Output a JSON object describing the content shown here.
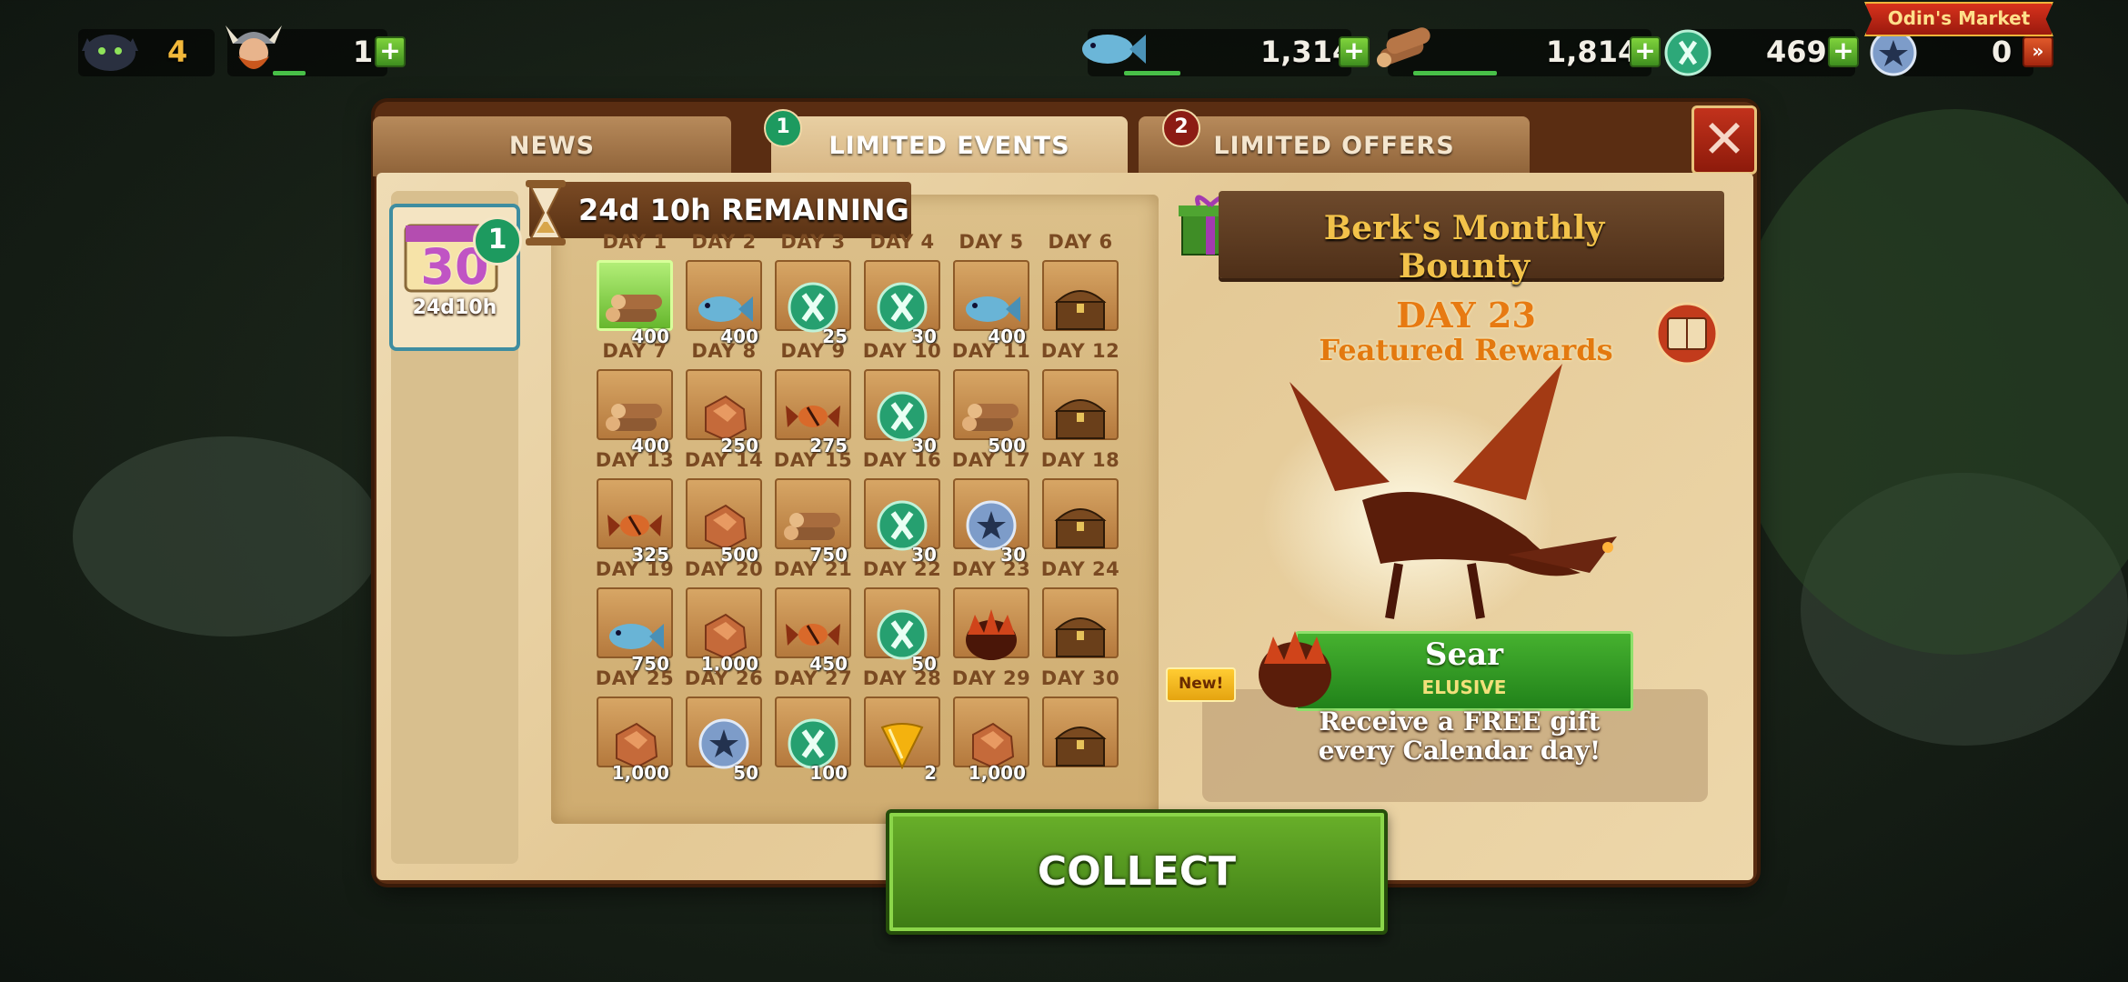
{
  "hud": {
    "dragons_count": "4",
    "vikings_count": "1",
    "fish_amount": "1,314",
    "wood_amount": "1,814",
    "runes_amount": "469",
    "coins_amount": "0",
    "market_label": "Odin's Market"
  },
  "tabs": {
    "news": "NEWS",
    "limited_events": "LIMITED EVENTS",
    "limited_events_badge": "1",
    "limited_offers": "LIMITED OFFERS",
    "limited_offers_badge": "2"
  },
  "sidebar": {
    "calendar_number": "30",
    "calendar_time": "24d10h",
    "calendar_badge": "1"
  },
  "calendar": {
    "remaining": "24d 10h REMAINING",
    "days": [
      {
        "label": "DAY 1",
        "reward": "wood",
        "amount": "400"
      },
      {
        "label": "DAY 2",
        "reward": "fish",
        "amount": "400"
      },
      {
        "label": "DAY 3",
        "reward": "rune",
        "amount": "25"
      },
      {
        "label": "DAY 4",
        "reward": "rune",
        "amount": "30"
      },
      {
        "label": "DAY 5",
        "reward": "fish",
        "amount": "400"
      },
      {
        "label": "DAY 6",
        "reward": "chest",
        "amount": ""
      },
      {
        "label": "DAY 7",
        "reward": "wood",
        "amount": "400"
      },
      {
        "label": "DAY 8",
        "reward": "iron",
        "amount": "250"
      },
      {
        "label": "DAY 9",
        "reward": "candy",
        "amount": "275"
      },
      {
        "label": "DAY 10",
        "reward": "rune",
        "amount": "30"
      },
      {
        "label": "DAY 11",
        "reward": "wood",
        "amount": "500"
      },
      {
        "label": "DAY 12",
        "reward": "chest",
        "amount": ""
      },
      {
        "label": "DAY 13",
        "reward": "candy",
        "amount": "325"
      },
      {
        "label": "DAY 14",
        "reward": "iron",
        "amount": "500"
      },
      {
        "label": "DAY 15",
        "reward": "wood",
        "amount": "750"
      },
      {
        "label": "DAY 16",
        "reward": "rune",
        "amount": "30"
      },
      {
        "label": "DAY 17",
        "reward": "coin",
        "amount": "30"
      },
      {
        "label": "DAY 18",
        "reward": "chest",
        "amount": ""
      },
      {
        "label": "DAY 19",
        "reward": "fish",
        "amount": "750"
      },
      {
        "label": "DAY 20",
        "reward": "iron",
        "amount": "1,000"
      },
      {
        "label": "DAY 21",
        "reward": "candy",
        "amount": "450"
      },
      {
        "label": "DAY 22",
        "reward": "rune",
        "amount": "50"
      },
      {
        "label": "DAY 23",
        "reward": "egg",
        "amount": ""
      },
      {
        "label": "DAY 24",
        "reward": "chest",
        "amount": ""
      },
      {
        "label": "DAY 25",
        "reward": "iron",
        "amount": "1,000"
      },
      {
        "label": "DAY 26",
        "reward": "coin",
        "amount": "50"
      },
      {
        "label": "DAY 27",
        "reward": "rune",
        "amount": "100"
      },
      {
        "label": "DAY 28",
        "reward": "gem",
        "amount": "2"
      },
      {
        "label": "DAY 29",
        "reward": "iron",
        "amount": "1,000"
      },
      {
        "label": "DAY 30",
        "reward": "chest",
        "amount": ""
      }
    ]
  },
  "featured": {
    "title": "Berk's Monthly Bounty",
    "day": "DAY 23",
    "subtitle": "Featured Rewards",
    "dragon_name": "Sear",
    "dragon_rarity": "ELUSIVE",
    "new_tag": "New!",
    "description_line1": "Receive a FREE gift",
    "description_line2": "every Calendar day!"
  },
  "collect_label": "COLLECT",
  "colors": {
    "accent_green": "#3d7b14",
    "frame_brown": "#5a2d12",
    "parchment": "#e4c996",
    "title_gold": "#f2c24a",
    "featured_orange": "#e77a12"
  }
}
